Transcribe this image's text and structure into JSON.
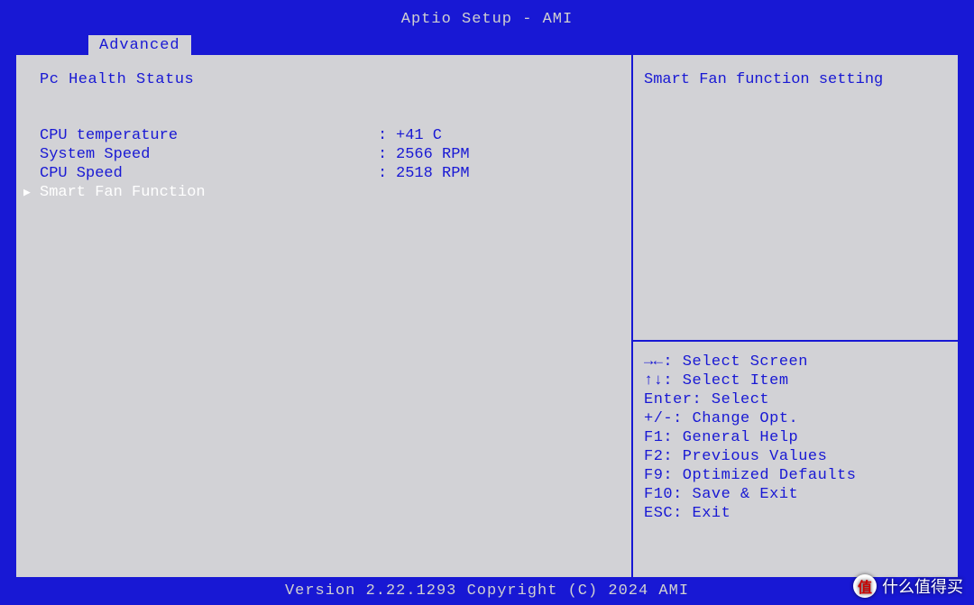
{
  "title": "Aptio Setup - AMI",
  "tab": "Advanced",
  "main": {
    "section_title": "Pc Health Status",
    "items": [
      {
        "label": "CPU temperature",
        "value": "+41 C"
      },
      {
        "label": "System Speed",
        "value": "2566 RPM"
      },
      {
        "label": "CPU Speed",
        "value": "2518 RPM"
      }
    ],
    "submenu": "Smart Fan Function"
  },
  "help": {
    "text": "Smart Fan function setting"
  },
  "keys": [
    "→←: Select Screen",
    "↑↓: Select Item",
    "Enter: Select",
    "+/-: Change Opt.",
    "F1: General Help",
    "F2: Previous Values",
    "F9: Optimized Defaults",
    "F10: Save & Exit",
    "ESC: Exit"
  ],
  "footer": "Version 2.22.1293 Copyright (C) 2024 AMI",
  "watermark": {
    "badge": "值",
    "text": "什么值得买"
  }
}
